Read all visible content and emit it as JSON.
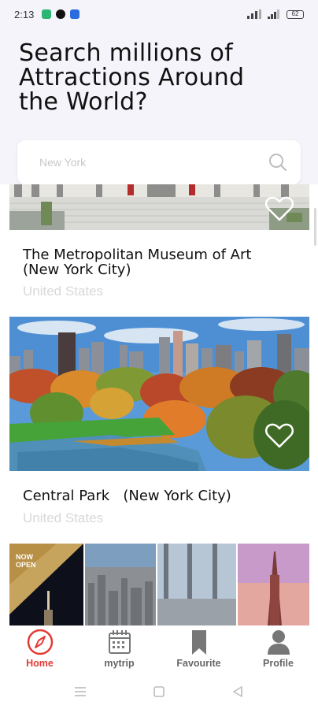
{
  "status_bar": {
    "time": "2:13",
    "battery": "62"
  },
  "header": {
    "headline": "Search millions of Attractions Around the World?"
  },
  "search": {
    "value": "",
    "placeholder": "New York"
  },
  "cards": [
    {
      "title": "The Metropolitan Museum of Art (New York City)",
      "country": "United States"
    },
    {
      "title": "Central Park   (New York City)",
      "country": "United States"
    },
    {
      "badge": "NOW OPEN"
    }
  ],
  "nav": [
    {
      "label": "Home",
      "icon": "compass-icon",
      "active": true
    },
    {
      "label": "mytrip",
      "icon": "calendar-icon",
      "active": false
    },
    {
      "label": "Favourite",
      "icon": "bookmark-icon",
      "active": false
    },
    {
      "label": "Profile",
      "icon": "person-icon",
      "active": false
    }
  ],
  "colors": {
    "accent": "#e53935",
    "header_bg": "#f4f4fa",
    "muted_text": "#d8d8d8"
  }
}
